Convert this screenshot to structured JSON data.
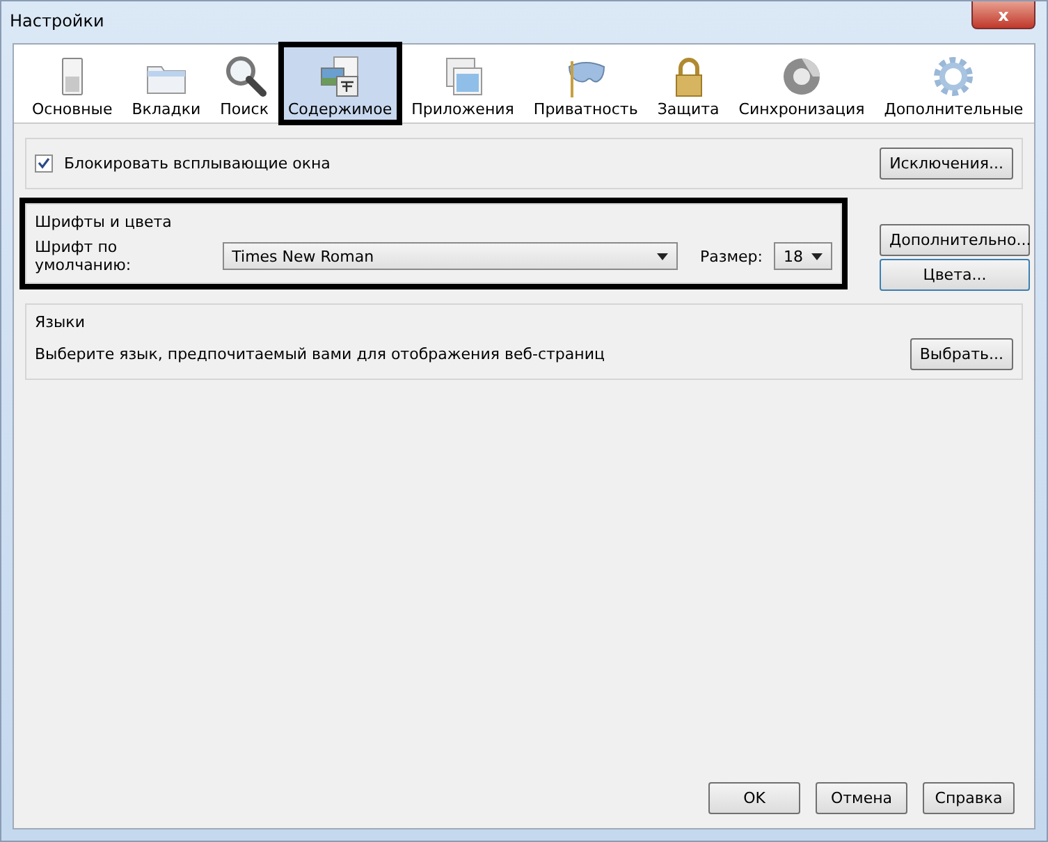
{
  "window": {
    "title": "Настройки",
    "close": "x"
  },
  "tabs": [
    {
      "label": "Основные",
      "kind": "switch",
      "selected": false,
      "highlighted": false
    },
    {
      "label": "Вкладки",
      "kind": "folder",
      "selected": false,
      "highlighted": false
    },
    {
      "label": "Поиск",
      "kind": "search",
      "selected": false,
      "highlighted": false
    },
    {
      "label": "Содержимое",
      "kind": "content",
      "selected": true,
      "highlighted": true
    },
    {
      "label": "Приложения",
      "kind": "apps",
      "selected": false,
      "highlighted": false
    },
    {
      "label": "Приватность",
      "kind": "mask",
      "selected": false,
      "highlighted": false
    },
    {
      "label": "Защита",
      "kind": "lock",
      "selected": false,
      "highlighted": false
    },
    {
      "label": "Синхронизация",
      "kind": "sync",
      "selected": false,
      "highlighted": false
    },
    {
      "label": "Дополнительные",
      "kind": "gear",
      "selected": false,
      "highlighted": false
    }
  ],
  "popups": {
    "label": "Блокировать всплывающие окна",
    "checked": true,
    "button": "Исключения..."
  },
  "fonts": {
    "title": "Шрифты и цвета",
    "highlighted": true,
    "default_label": "Шрифт по умолчанию:",
    "default_value": "Times New Roman",
    "size_label": "Размер:",
    "size_value": "18",
    "advanced_button": "Дополнительно...",
    "colors_button": "Цвета..."
  },
  "languages": {
    "title": "Языки",
    "text": "Выберите язык, предпочитаемый вами для отображения веб-страниц",
    "button": "Выбрать..."
  },
  "buttons": [
    "OK",
    "Отмена",
    "Справка"
  ]
}
